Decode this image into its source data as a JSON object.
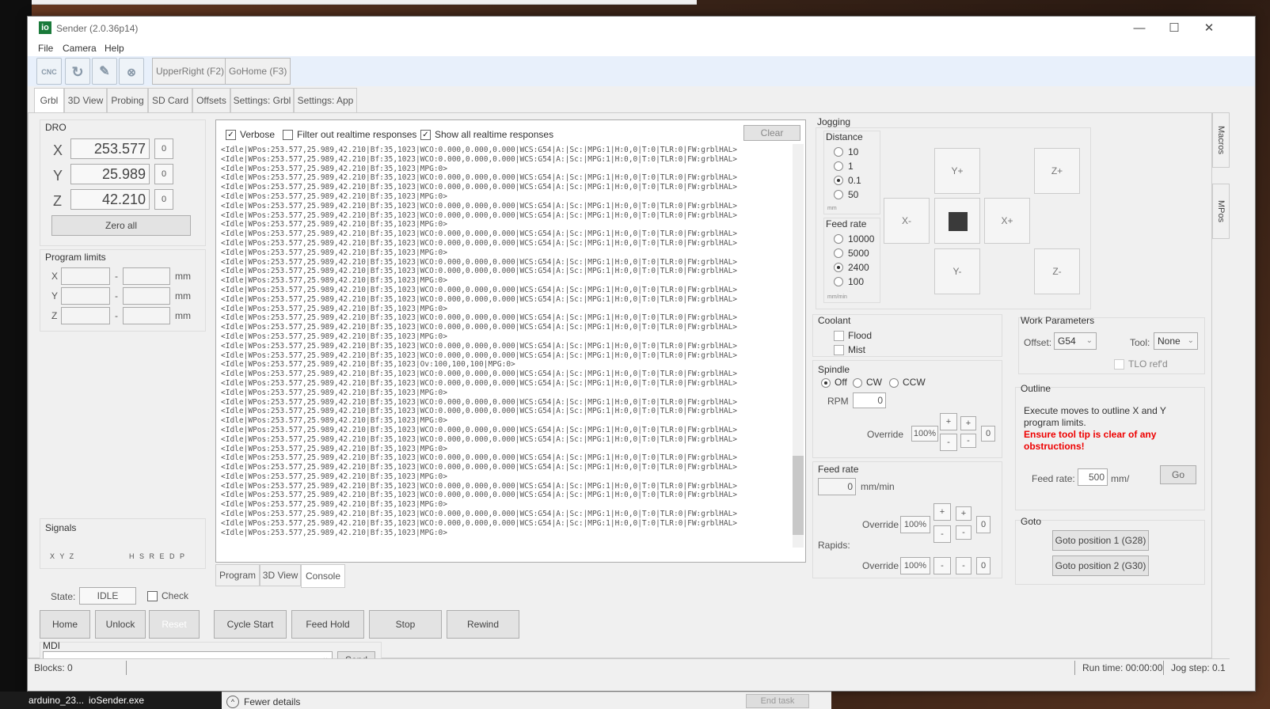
{
  "window": {
    "title": "Sender (2.0.36p14)",
    "logo": "io",
    "minimize": "—",
    "maximize": "☐",
    "close": "✕"
  },
  "menu": [
    "File",
    "Camera",
    "Help"
  ],
  "toolbar": {
    "icons": [
      "cnc-file-icon",
      "reload-icon",
      "edit-icon",
      "close-file-icon"
    ],
    "cnc_label": "CNC",
    "buttons": [
      "UpperRight (F2)",
      "GoHome (F3)"
    ]
  },
  "tabs": [
    "Grbl",
    "3D View",
    "Probing",
    "SD Card",
    "Offsets",
    "Settings: Grbl",
    "Settings: App"
  ],
  "side_tabs": [
    "Macros",
    "MPos"
  ],
  "dro": {
    "title": "DRO",
    "axes": [
      {
        "label": "X",
        "value": "253.577",
        "offset": "0"
      },
      {
        "label": "Y",
        "value": "25.989",
        "offset": "0"
      },
      {
        "label": "Z",
        "value": "42.210",
        "offset": "0"
      }
    ],
    "zero_all": "Zero all"
  },
  "program_limits": {
    "title": "Program limits",
    "rows": [
      "X",
      "Y",
      "Z"
    ],
    "unit": "mm",
    "dash": "-"
  },
  "signals": {
    "title": "Signals",
    "left": "X Y Z",
    "right": "H S R E D P"
  },
  "state": {
    "label": "State:",
    "value": "IDLE",
    "check": "Check"
  },
  "actions": {
    "home": "Home",
    "unlock": "Unlock",
    "reset": "Reset",
    "cycle_start": "Cycle Start",
    "feed_hold": "Feed Hold",
    "stop": "Stop",
    "rewind": "Rewind"
  },
  "mdi": {
    "label": "MDI",
    "send": "Send"
  },
  "console": {
    "verbose": "Verbose",
    "filter": "Filter out realtime responses",
    "show_all": "Show all realtime responses",
    "clear": "Clear",
    "lines": [
      "<Idle|WPos:253.577,25.989,42.210|Bf:35,1023|WCO:0.000,0.000,0.000|WCS:G54|A:|Sc:|MPG:1|H:0,0|T:0|TLR:0|FW:grblHAL>",
      "<Idle|WPos:253.577,25.989,42.210|Bf:35,1023|WCO:0.000,0.000,0.000|WCS:G54|A:|Sc:|MPG:1|H:0,0|T:0|TLR:0|FW:grblHAL>",
      "<Idle|WPos:253.577,25.989,42.210|Bf:35,1023|MPG:0>",
      "<Idle|WPos:253.577,25.989,42.210|Bf:35,1023|WCO:0.000,0.000,0.000|WCS:G54|A:|Sc:|MPG:1|H:0,0|T:0|TLR:0|FW:grblHAL>",
      "<Idle|WPos:253.577,25.989,42.210|Bf:35,1023|WCO:0.000,0.000,0.000|WCS:G54|A:|Sc:|MPG:1|H:0,0|T:0|TLR:0|FW:grblHAL>",
      "<Idle|WPos:253.577,25.989,42.210|Bf:35,1023|MPG:0>",
      "<Idle|WPos:253.577,25.989,42.210|Bf:35,1023|WCO:0.000,0.000,0.000|WCS:G54|A:|Sc:|MPG:1|H:0,0|T:0|TLR:0|FW:grblHAL>",
      "<Idle|WPos:253.577,25.989,42.210|Bf:35,1023|WCO:0.000,0.000,0.000|WCS:G54|A:|Sc:|MPG:1|H:0,0|T:0|TLR:0|FW:grblHAL>",
      "<Idle|WPos:253.577,25.989,42.210|Bf:35,1023|MPG:0>",
      "<Idle|WPos:253.577,25.989,42.210|Bf:35,1023|WCO:0.000,0.000,0.000|WCS:G54|A:|Sc:|MPG:1|H:0,0|T:0|TLR:0|FW:grblHAL>",
      "<Idle|WPos:253.577,25.989,42.210|Bf:35,1023|WCO:0.000,0.000,0.000|WCS:G54|A:|Sc:|MPG:1|H:0,0|T:0|TLR:0|FW:grblHAL>",
      "<Idle|WPos:253.577,25.989,42.210|Bf:35,1023|MPG:0>",
      "<Idle|WPos:253.577,25.989,42.210|Bf:35,1023|WCO:0.000,0.000,0.000|WCS:G54|A:|Sc:|MPG:1|H:0,0|T:0|TLR:0|FW:grblHAL>",
      "<Idle|WPos:253.577,25.989,42.210|Bf:35,1023|WCO:0.000,0.000,0.000|WCS:G54|A:|Sc:|MPG:1|H:0,0|T:0|TLR:0|FW:grblHAL>",
      "<Idle|WPos:253.577,25.989,42.210|Bf:35,1023|MPG:0>",
      "<Idle|WPos:253.577,25.989,42.210|Bf:35,1023|WCO:0.000,0.000,0.000|WCS:G54|A:|Sc:|MPG:1|H:0,0|T:0|TLR:0|FW:grblHAL>",
      "<Idle|WPos:253.577,25.989,42.210|Bf:35,1023|WCO:0.000,0.000,0.000|WCS:G54|A:|Sc:|MPG:1|H:0,0|T:0|TLR:0|FW:grblHAL>",
      "<Idle|WPos:253.577,25.989,42.210|Bf:35,1023|MPG:0>",
      "<Idle|WPos:253.577,25.989,42.210|Bf:35,1023|WCO:0.000,0.000,0.000|WCS:G54|A:|Sc:|MPG:1|H:0,0|T:0|TLR:0|FW:grblHAL>",
      "<Idle|WPos:253.577,25.989,42.210|Bf:35,1023|WCO:0.000,0.000,0.000|WCS:G54|A:|Sc:|MPG:1|H:0,0|T:0|TLR:0|FW:grblHAL>",
      "<Idle|WPos:253.577,25.989,42.210|Bf:35,1023|MPG:0>",
      "<Idle|WPos:253.577,25.989,42.210|Bf:35,1023|WCO:0.000,0.000,0.000|WCS:G54|A:|Sc:|MPG:1|H:0,0|T:0|TLR:0|FW:grblHAL>",
      "<Idle|WPos:253.577,25.989,42.210|Bf:35,1023|WCO:0.000,0.000,0.000|WCS:G54|A:|Sc:|MPG:1|H:0,0|T:0|TLR:0|FW:grblHAL>",
      "<Idle|WPos:253.577,25.989,42.210|Bf:35,1023|Ov:100,100,100|MPG:0>",
      "<Idle|WPos:253.577,25.989,42.210|Bf:35,1023|WCO:0.000,0.000,0.000|WCS:G54|A:|Sc:|MPG:1|H:0,0|T:0|TLR:0|FW:grblHAL>",
      "<Idle|WPos:253.577,25.989,42.210|Bf:35,1023|WCO:0.000,0.000,0.000|WCS:G54|A:|Sc:|MPG:1|H:0,0|T:0|TLR:0|FW:grblHAL>",
      "<Idle|WPos:253.577,25.989,42.210|Bf:35,1023|MPG:0>",
      "<Idle|WPos:253.577,25.989,42.210|Bf:35,1023|WCO:0.000,0.000,0.000|WCS:G54|A:|Sc:|MPG:1|H:0,0|T:0|TLR:0|FW:grblHAL>",
      "<Idle|WPos:253.577,25.989,42.210|Bf:35,1023|WCO:0.000,0.000,0.000|WCS:G54|A:|Sc:|MPG:1|H:0,0|T:0|TLR:0|FW:grblHAL>",
      "<Idle|WPos:253.577,25.989,42.210|Bf:35,1023|MPG:0>",
      "<Idle|WPos:253.577,25.989,42.210|Bf:35,1023|WCO:0.000,0.000,0.000|WCS:G54|A:|Sc:|MPG:1|H:0,0|T:0|TLR:0|FW:grblHAL>",
      "<Idle|WPos:253.577,25.989,42.210|Bf:35,1023|WCO:0.000,0.000,0.000|WCS:G54|A:|Sc:|MPG:1|H:0,0|T:0|TLR:0|FW:grblHAL>",
      "<Idle|WPos:253.577,25.989,42.210|Bf:35,1023|MPG:0>",
      "<Idle|WPos:253.577,25.989,42.210|Bf:35,1023|WCO:0.000,0.000,0.000|WCS:G54|A:|Sc:|MPG:1|H:0,0|T:0|TLR:0|FW:grblHAL>",
      "<Idle|WPos:253.577,25.989,42.210|Bf:35,1023|WCO:0.000,0.000,0.000|WCS:G54|A:|Sc:|MPG:1|H:0,0|T:0|TLR:0|FW:grblHAL>",
      "<Idle|WPos:253.577,25.989,42.210|Bf:35,1023|MPG:0>",
      "<Idle|WPos:253.577,25.989,42.210|Bf:35,1023|WCO:0.000,0.000,0.000|WCS:G54|A:|Sc:|MPG:1|H:0,0|T:0|TLR:0|FW:grblHAL>",
      "<Idle|WPos:253.577,25.989,42.210|Bf:35,1023|WCO:0.000,0.000,0.000|WCS:G54|A:|Sc:|MPG:1|H:0,0|T:0|TLR:0|FW:grblHAL>",
      "<Idle|WPos:253.577,25.989,42.210|Bf:35,1023|MPG:0>",
      "<Idle|WPos:253.577,25.989,42.210|Bf:35,1023|WCO:0.000,0.000,0.000|WCS:G54|A:|Sc:|MPG:1|H:0,0|T:0|TLR:0|FW:grblHAL>",
      "<Idle|WPos:253.577,25.989,42.210|Bf:35,1023|WCO:0.000,0.000,0.000|WCS:G54|A:|Sc:|MPG:1|H:0,0|T:0|TLR:0|FW:grblHAL>",
      "<Idle|WPos:253.577,25.989,42.210|Bf:35,1023|MPG:0>"
    ]
  },
  "bottom_tabs": [
    "Program",
    "3D View",
    "Console"
  ],
  "jogging": {
    "title": "Jogging",
    "distance_title": "Distance",
    "distances": [
      "10",
      "1",
      "0.1",
      "50"
    ],
    "distance_selected": 2,
    "distance_unit": "mm",
    "feed_title": "Feed rate",
    "feeds": [
      "10000",
      "5000",
      "2400",
      "100"
    ],
    "feed_selected": 2,
    "feed_unit": "mm/min",
    "buttons": {
      "yp": "Y+",
      "zp": "Z+",
      "xm": "X-",
      "xp": "X+",
      "ym": "Y-",
      "zm": "Z-"
    }
  },
  "coolant": {
    "title": "Coolant",
    "flood": "Flood",
    "mist": "Mist"
  },
  "spindle": {
    "title": "Spindle",
    "off": "Off",
    "cw": "CW",
    "ccw": "CCW",
    "rpm_label": "RPM",
    "rpm": "0",
    "override_label": "Override",
    "override": "100%",
    "plus": "+",
    "minus": "-",
    "count": "0"
  },
  "feed": {
    "title": "Feed rate",
    "value": "0",
    "unit": "mm/min",
    "override_label": "Override",
    "override": "100%",
    "count": "0",
    "rapids": "Rapids:",
    "rapid_override": "100%",
    "rapid_count": "0",
    "plus": "+",
    "minus": "-"
  },
  "work": {
    "title": "Work Parameters",
    "offset_label": "Offset:",
    "offset": "G54",
    "tool_label": "Tool:",
    "tool": "None",
    "tlo": "TLO ref'd"
  },
  "outline": {
    "title": "Outline",
    "text": "Execute moves to outline X and Y program limits.",
    "warning": "Ensure tool tip is clear of any obstructions!",
    "feed_label": "Feed rate:",
    "feed": "500",
    "unit": "mm/",
    "go": "Go"
  },
  "goto": {
    "title": "Goto",
    "pos1": "Goto position 1 (G28)",
    "pos2": "Goto position 2 (G30)"
  },
  "status": {
    "blocks": "Blocks: 0",
    "runtime": "Run time: 00:00:00",
    "jogstep": "Jog step: 0.1"
  },
  "taskbar": {
    "item1": "arduino_23...",
    "item2": "ioSender.exe",
    "fewer": "Fewer details",
    "end_task": "End task"
  }
}
